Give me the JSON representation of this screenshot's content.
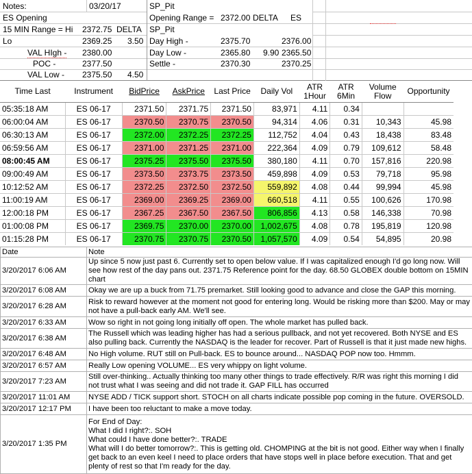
{
  "top_left": {
    "notes_label": "Notes:",
    "date": "03/20/17",
    "es_opening": "ES Opening",
    "range_label": "15 MIN Range = Hi",
    "hi": "2372.75",
    "delta_label": "DELTA",
    "lo_label": "Lo",
    "lo": "2369.25",
    "delta": "3.50",
    "val_high_label": "VAL HIgh  -",
    "val_high": "2380.00",
    "poc_label": "POC  -",
    "poc": "2377.50",
    "val_low_label": "VAL Low  -",
    "val_low": "2375.50",
    "val_delta": "4.50"
  },
  "top_right": {
    "sp_pit": "SP_Pit",
    "opening_range_label": "Opening Range =",
    "opening_range": "2372.00",
    "delta_label": "DELTA",
    "es_label": "ES",
    "sp_pit2": "SP_Pit",
    "day_high_label": "Day High -",
    "day_high": "2375.70",
    "day_high_es": "2376.00",
    "day_low_label": "Day Low -",
    "day_low": "2365.80",
    "day_low_delta": "9.90",
    "day_low_es": "2365.50",
    "settle_label": "Settle -",
    "settle": "2370.30",
    "settle_es": "2370.25"
  },
  "trade_table": {
    "headers": [
      "Time Last",
      "Instrument",
      "BidPrice",
      "AskPrice",
      "Last Price",
      "Daily Vol",
      "ATR 1Hour",
      "ATR 6Min",
      "Volume Flow",
      "Opportunity"
    ],
    "rows": [
      {
        "time": "05:35:18 AM",
        "inst": "ES 06-17",
        "bid": "2371.50",
        "ask": "2371.75",
        "last": "2371.50",
        "vol": "83,971",
        "atr1": "4.11",
        "atr6": "0.34",
        "flow": "",
        "opp": "",
        "c": "",
        "vc": ""
      },
      {
        "time": "06:00:04 AM",
        "inst": "ES 06-17",
        "bid": "2370.50",
        "ask": "2370.75",
        "last": "2370.50",
        "vol": "94,314",
        "atr1": "4.06",
        "atr6": "0.31",
        "flow": "10,343",
        "opp": "45.98",
        "c": "red",
        "vc": ""
      },
      {
        "time": "06:30:13 AM",
        "inst": "ES 06-17",
        "bid": "2372.00",
        "ask": "2372.25",
        "last": "2372.25",
        "vol": "112,752",
        "atr1": "4.04",
        "atr6": "0.43",
        "flow": "18,438",
        "opp": "83.48",
        "c": "green",
        "vc": ""
      },
      {
        "time": "06:59:56 AM",
        "inst": "ES 06-17",
        "bid": "2371.00",
        "ask": "2371.25",
        "last": "2371.00",
        "vol": "222,364",
        "atr1": "4.09",
        "atr6": "0.79",
        "flow": "109,612",
        "opp": "58.48",
        "c": "red",
        "vc": ""
      },
      {
        "time": "08:00:45 AM",
        "inst": "ES 06-17",
        "bid": "2375.25",
        "ask": "2375.50",
        "last": "2375.50",
        "vol": "380,180",
        "atr1": "4.11",
        "atr6": "0.70",
        "flow": "157,816",
        "opp": "220.98",
        "c": "green",
        "vc": "",
        "bold": true
      },
      {
        "time": "09:00:49 AM",
        "inst": "ES 06-17",
        "bid": "2373.50",
        "ask": "2373.75",
        "last": "2373.50",
        "vol": "459,898",
        "atr1": "4.09",
        "atr6": "0.53",
        "flow": "79,718",
        "opp": "95.98",
        "c": "red",
        "vc": ""
      },
      {
        "time": "10:12:52 AM",
        "inst": "ES 06-17",
        "bid": "2372.25",
        "ask": "2372.50",
        "last": "2372.50",
        "vol": "559,892",
        "atr1": "4.08",
        "atr6": "0.44",
        "flow": "99,994",
        "opp": "45.98",
        "c": "red",
        "vc": "yellow"
      },
      {
        "time": "11:00:19 AM",
        "inst": "ES 06-17",
        "bid": "2369.00",
        "ask": "2369.25",
        "last": "2369.00",
        "vol": "660,518",
        "atr1": "4.11",
        "atr6": "0.55",
        "flow": "100,626",
        "opp": "170.98",
        "c": "red",
        "vc": "yellow"
      },
      {
        "time": "12:00:18 PM",
        "inst": "ES 06-17",
        "bid": "2367.25",
        "ask": "2367.50",
        "last": "2367.50",
        "vol": "806,856",
        "atr1": "4.13",
        "atr6": "0.58",
        "flow": "146,338",
        "opp": "70.98",
        "c": "red",
        "vc": "green"
      },
      {
        "time": "01:00:08 PM",
        "inst": "ES 06-17",
        "bid": "2369.75",
        "ask": "2370.00",
        "last": "2370.00",
        "vol": "1,002,675",
        "atr1": "4.08",
        "atr6": "0.78",
        "flow": "195,819",
        "opp": "120.98",
        "c": "green",
        "vc": "green"
      },
      {
        "time": "01:15:28 PM",
        "inst": "ES 06-17",
        "bid": "2370.75",
        "ask": "2370.75",
        "last": "2370.50",
        "vol": "1,057,570",
        "atr1": "4.09",
        "atr6": "0.54",
        "flow": "54,895",
        "opp": "20.98",
        "c": "green",
        "vc": "green"
      }
    ]
  },
  "notes_table": {
    "headers": [
      "Date",
      "Note"
    ],
    "rows": [
      {
        "date": "3/20/2017 6:06 AM",
        "note": "Up since 5 now just past 6.  Currently set to open below value.  If I was capitalized enough I'd go long now.  Will see how rest of the day pans out.  2371.75 Reference point for the day.  68.50 GLOBEX double bottom on 15MIN chart"
      },
      {
        "date": "3/20/2017 6:08 AM",
        "note": "Okay we are up a buck from 71.75 premarket.  Still looking good to advance and close the GAP this morning."
      },
      {
        "date": "3/20/2017 6:28 AM",
        "note": "Risk to reward however at the moment not good for entering long.  Would be risking more than $200.  May or may not have a pull-back early AM.  We'll see."
      },
      {
        "date": "3/20/2017 6:33 AM",
        "note": "Wow so right in not going long initially off open.  The whole market has pulled back."
      },
      {
        "date": "3/20/2017 6:38 AM",
        "note": "The Russell which was leading higher has had a serious pullback, and not yet recovered.  Both NYSE and ES also pulling back.  Currently the NASDAQ is the leader for recover.  Part of Russell is that it just made new highs."
      },
      {
        "date": "3/20/2017 6:48 AM",
        "note": "No High volume.  RUT still on Pull-back.  ES to bounce around... NASDAQ POP now too.  Hmmm."
      },
      {
        "date": "3/20/2017 6:57 AM",
        "note": "Really Low opening VOLUME... ES very whippy on light volume."
      },
      {
        "date": "3/20/2017 7:23 AM",
        "note": "Still over-thinking.. Actually thinking too many other things to trade effectively.  R/R was right this morning I did not trust what I was seeing and did not trade it.  GAP FILL has occurred"
      },
      {
        "date": "3/20/2017 11:01 AM",
        "note": "NYSE ADD / TICK support short.  STOCH on all charts indicate possible pop coming in the future.  OVERSOLD."
      },
      {
        "date": "3/20/2017 12:17 PM",
        "note": "I have been too reluctant to make a move today."
      },
      {
        "date": "3/20/2017 1:35 PM",
        "note_lines": [
          "For End of Day:",
          "What I did I right?:.  SOH",
          "What could I have done better?:.  TRADE",
          "What will I do better tomorrow?:.  This is getting old.  CHOMPING at the bit is not good.  Either way when I finally get back to an even keel I need to place orders that have stops well in place before execution.  That and get plenty of rest so that I'm ready for the day."
        ]
      }
    ]
  }
}
